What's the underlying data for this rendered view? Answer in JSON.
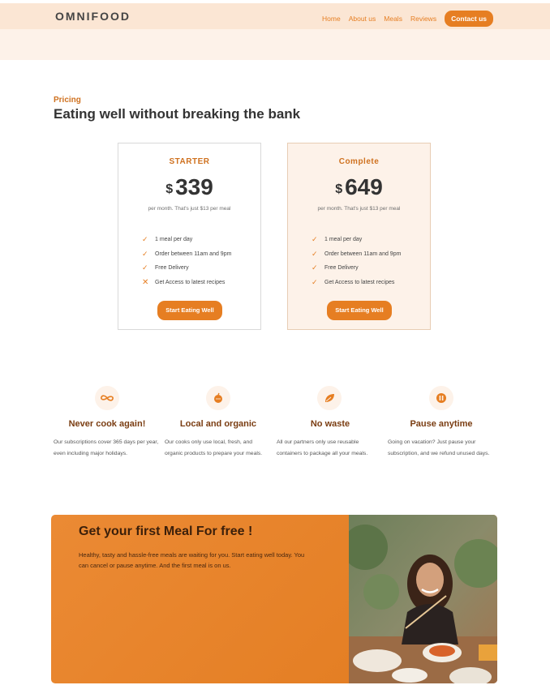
{
  "header": {
    "logo": "OMNIFOOD",
    "nav": [
      "Home",
      "About us",
      "Meals",
      "Reviews"
    ],
    "cta": "Contact us"
  },
  "pricing": {
    "subheading": "Pricing",
    "heading": "Eating well without breaking the bank",
    "plans": [
      {
        "name": "STARTER",
        "currency": "$",
        "price": "339",
        "per_meal": "per month. That's just $13 per meal",
        "features": [
          {
            "text": "1 meal per day",
            "included": true
          },
          {
            "text": "Order between 11am and 9pm",
            "included": true
          },
          {
            "text": "Free Delivery",
            "included": true
          },
          {
            "text": "Get Access to latest recipes",
            "included": false
          }
        ],
        "button": "Start Eating Well"
      },
      {
        "name": "Complete",
        "currency": "$",
        "price": "649",
        "per_meal": "per month. That's just $13 per meal",
        "features": [
          {
            "text": "1 meal per day",
            "included": true
          },
          {
            "text": "Order between 11am and 9pm",
            "included": true
          },
          {
            "text": "Free Delivery",
            "included": true
          },
          {
            "text": "Get Access to latest recipes",
            "included": true
          }
        ],
        "button": "Start Eating Well"
      }
    ]
  },
  "features": [
    {
      "icon": "infinity-icon",
      "title": "Never cook again!",
      "desc": "Our subscriptions cover 365 days per year, even including major holidays."
    },
    {
      "icon": "apple-icon",
      "title": "Local and organic",
      "desc": "Our cooks only use local, fresh, and organic products to prepare your meals."
    },
    {
      "icon": "leaf-icon",
      "title": "No waste",
      "desc": "All our partners only use reusable containers to package all your meals."
    },
    {
      "icon": "pause-icon",
      "title": "Pause anytime",
      "desc": "Going on vacation? Just pause your subscription, and we refund unused days."
    }
  ],
  "cta": {
    "title": "Get your first Meal For free !",
    "text": "Healthy, tasty and hassle-free meals are waiting for you. Start eating well today. You can cancel or pause anytime. And the first meal is on us."
  },
  "colors": {
    "accent": "#e67e22",
    "accent_light": "#fdf2e9",
    "dark_accent": "#7a3d12"
  }
}
